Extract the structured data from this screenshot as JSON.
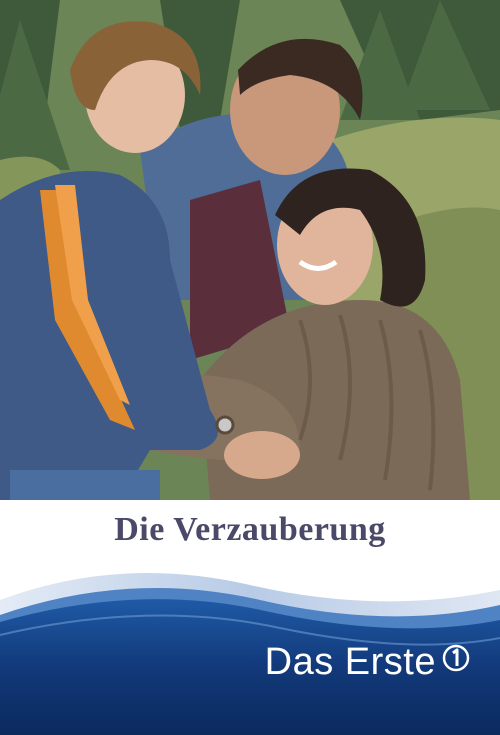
{
  "poster": {
    "title": "Die Verzauberung",
    "broadcaster": "Das Erste",
    "broadcaster_logo_icon": "ard-one-logo-icon",
    "colors": {
      "title_text": "#4a4a68",
      "footer_blue_dark": "#0b2a5e",
      "footer_blue_mid": "#1f5aa6",
      "wave_light": "#cfdcee",
      "brand_text": "#ffffff"
    }
  }
}
